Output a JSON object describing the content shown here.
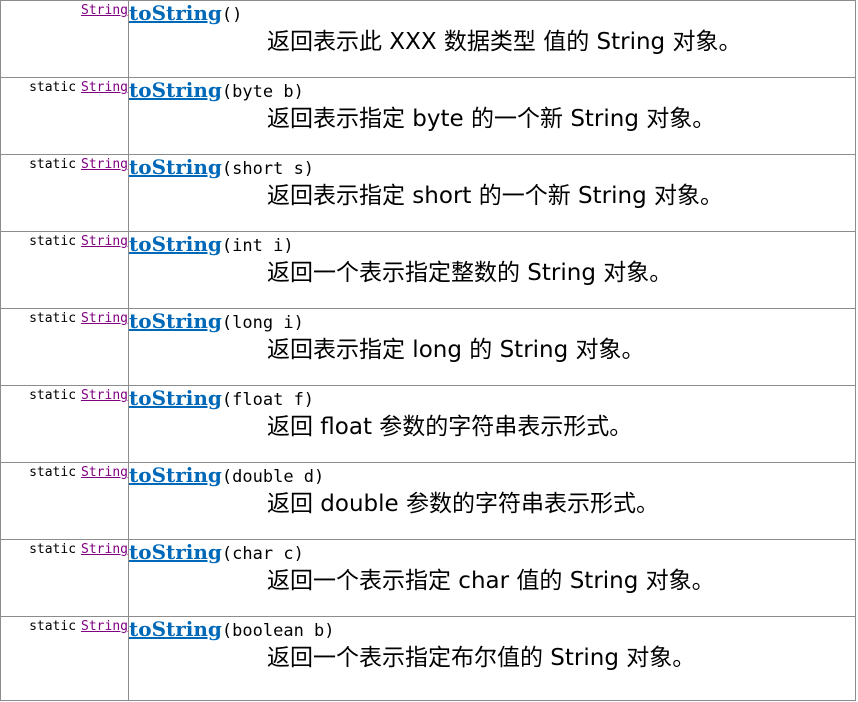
{
  "methods": [
    {
      "modifier": "",
      "return_type": "String",
      "name": "toString",
      "params": "()",
      "description": "返回表示此 XXX 数据类型 值的 String 对象。"
    },
    {
      "modifier": "static",
      "return_type": "String",
      "name": "toString",
      "params": "(byte b)",
      "description": "返回表示指定 byte 的一个新 String 对象。"
    },
    {
      "modifier": "static",
      "return_type": "String",
      "name": "toString",
      "params": "(short s)",
      "description": "返回表示指定 short 的一个新 String 对象。"
    },
    {
      "modifier": "static",
      "return_type": "String",
      "name": "toString",
      "params": "(int i)",
      "description": "返回一个表示指定整数的 String 对象。"
    },
    {
      "modifier": "static",
      "return_type": "String",
      "name": "toString",
      "params": "(long i)",
      "description": "返回表示指定 long 的 String 对象。"
    },
    {
      "modifier": "static",
      "return_type": "String",
      "name": "toString",
      "params": "(float f)",
      "description": "返回 float 参数的字符串表示形式。"
    },
    {
      "modifier": "static",
      "return_type": "String",
      "name": "toString",
      "params": "(double d)",
      "description": "返回 double 参数的字符串表示形式。"
    },
    {
      "modifier": "static",
      "return_type": "String",
      "name": "toString",
      "params": "(char c)",
      "description": "返回一个表示指定 char 值的 String 对象。"
    },
    {
      "modifier": "static",
      "return_type": "String",
      "name": "toString",
      "params": "(boolean b)",
      "description": "返回一个表示指定布尔值的 String 对象。"
    }
  ],
  "colors": {
    "method_link": "#0068b8",
    "type_link": "#800080",
    "border": "#8c8c8c"
  }
}
